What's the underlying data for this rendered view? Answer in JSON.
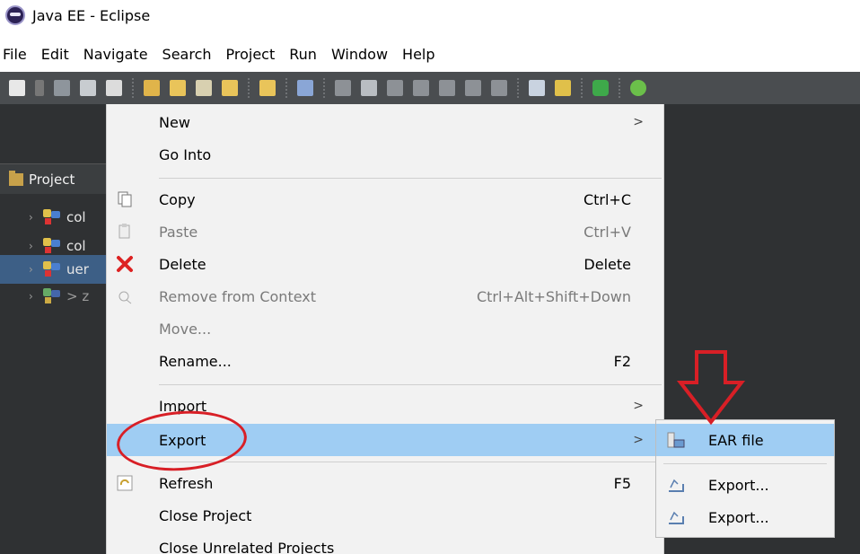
{
  "window": {
    "title": "Java EE - Eclipse"
  },
  "menubar": [
    "File",
    "Edit",
    "Navigate",
    "Search",
    "Project",
    "Run",
    "Window",
    "Help"
  ],
  "view": {
    "tab_label": "Project"
  },
  "tree": [
    {
      "label": "col",
      "selected": false
    },
    {
      "label": "col",
      "selected": false
    },
    {
      "label": "uer",
      "selected": true
    },
    {
      "label": "> z",
      "selected": false
    }
  ],
  "context_menu": {
    "new": {
      "label": "New",
      "arrow": ">"
    },
    "go_into": {
      "label": "Go Into"
    },
    "copy": {
      "label": "Copy",
      "shortcut": "Ctrl+C"
    },
    "paste": {
      "label": "Paste",
      "shortcut": "Ctrl+V"
    },
    "delete": {
      "label": "Delete",
      "shortcut": "Delete"
    },
    "remove_from_context": {
      "label": "Remove from Context",
      "shortcut": "Ctrl+Alt+Shift+Down"
    },
    "move": {
      "label": "Move..."
    },
    "rename": {
      "label": "Rename...",
      "shortcut": "F2"
    },
    "import": {
      "label": "Import",
      "arrow": ">"
    },
    "export": {
      "label": "Export",
      "arrow": ">"
    },
    "refresh": {
      "label": "Refresh",
      "shortcut": "F5"
    },
    "close_project": {
      "label": "Close Project"
    },
    "close_unrelated": {
      "label": "Close Unrelated Projects"
    }
  },
  "submenu": {
    "ear_file": {
      "label": "EAR file"
    },
    "export_1": {
      "label": "Export..."
    },
    "export_2": {
      "label": "Export..."
    }
  },
  "colors": {
    "toolbar_bg": "#4a4d50",
    "dark_bg": "#2f3133",
    "menu_bg": "#f2f2f2",
    "highlight": "#9fcdf3",
    "annotation_red": "#d81f26"
  }
}
